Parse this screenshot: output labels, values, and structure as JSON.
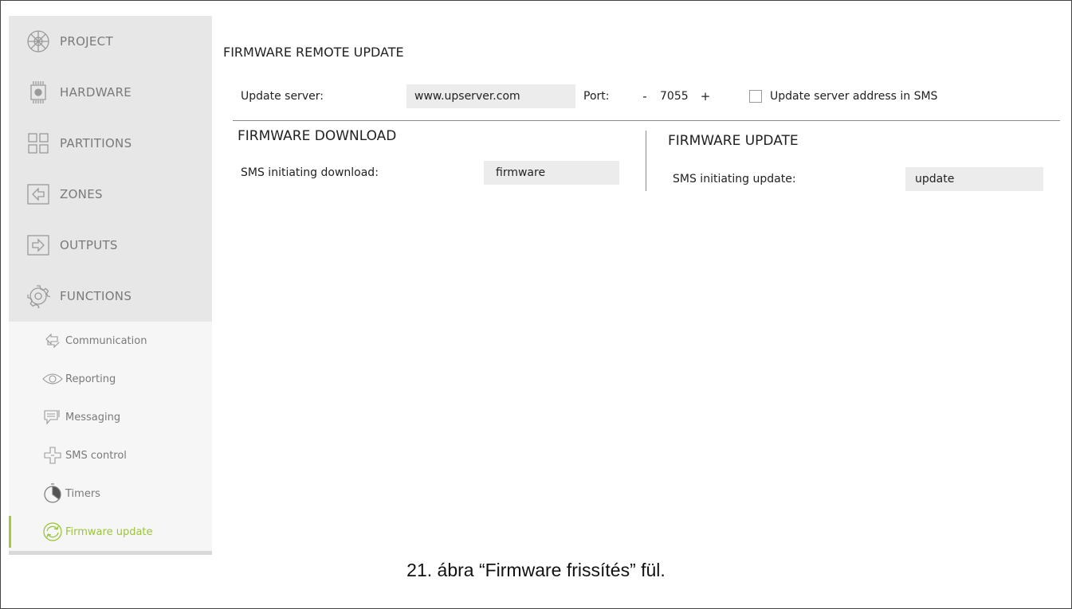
{
  "sidebar": {
    "main_items": [
      {
        "label": "PROJECT",
        "icon": "project-icon"
      },
      {
        "label": "HARDWARE",
        "icon": "hardware-icon"
      },
      {
        "label": "PARTITIONS",
        "icon": "partitions-icon"
      },
      {
        "label": "ZONES",
        "icon": "zones-icon"
      },
      {
        "label": "OUTPUTS",
        "icon": "outputs-icon"
      },
      {
        "label": "FUNCTIONS",
        "icon": "functions-icon"
      }
    ],
    "sub_items": [
      {
        "label": "Communication",
        "icon": "communication-icon"
      },
      {
        "label": "Reporting",
        "icon": "reporting-icon"
      },
      {
        "label": "Messaging",
        "icon": "messaging-icon"
      },
      {
        "label": "SMS control",
        "icon": "sms-control-icon"
      },
      {
        "label": "Timers",
        "icon": "timers-icon"
      },
      {
        "label": "Firmware update",
        "icon": "firmware-update-icon",
        "active": true
      }
    ],
    "active_color": "#a6c83b"
  },
  "remote_update": {
    "title": "FIRMWARE REMOTE UPDATE",
    "server_label": "Update server:",
    "server_value": "www.upserver.com",
    "port_label": "Port:",
    "port_minus": "-",
    "port_value": "7055",
    "port_plus": "+",
    "sms_address_label": "Update server address in SMS",
    "sms_address_checked": false
  },
  "download": {
    "title": "FIRMWARE DOWNLOAD",
    "label": "SMS initiating download:",
    "value": "firmware"
  },
  "update": {
    "title": "FIRMWARE UPDATE",
    "label": "SMS initiating update:",
    "value": "update"
  },
  "caption": "21. ábra “Firmware frissítés” fül."
}
